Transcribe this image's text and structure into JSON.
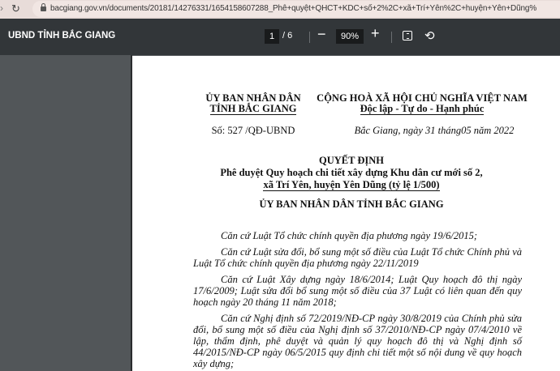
{
  "browser": {
    "url": "bacgiang.gov.vn/documents/20181/14276331/1654158607288_Phê+quyệt+QHCT+KDC+số+2%2C+xã+Trí+Yên%2C+huyện+Yên+Dũng%"
  },
  "toolbar": {
    "title": "UBND TỈNH BẮC GIANG",
    "current_page": "1",
    "page_total": "/ 6",
    "zoom": "90%",
    "zoom_out": "−",
    "zoom_in": "+",
    "rotate_icon": "⟲"
  },
  "document": {
    "left_header": [
      "ỦY BAN NHÂN DÂN",
      "TỈNH BẮC GIANG"
    ],
    "number": "Số: 527 /QĐ-UBND",
    "right_header": [
      "CỘNG HOÀ XÃ HỘI CHỦ NGHĨA VIỆT NAM",
      "Độc lập - Tự do - Hạnh phúc"
    ],
    "date": "Bắc Giang, ngày 31 tháng05  năm 2022",
    "title": "QUYẾT ĐỊNH",
    "subtitle": [
      "Phê duyệt Quy hoạch chi tiết xây dựng Khu dân cư mới số 2,",
      "xã Trí Yên, huyện Yên Dũng (tỷ lệ 1/500)"
    ],
    "authority": "ỦY BAN NHÂN DÂN TỈNH BẮC GIANG",
    "lines": [
      "Căn cứ Luật Tổ chức chính quyền địa phương ngày 19/6/2015;",
      "Căn cứ Luật sửa đổi, bổ sung một số điều của Luật Tổ chức Chính phủ và",
      "Luật Tổ chức chính quyền địa phương ngày 22/11/2019",
      "Căn cứ Luật Xây dựng ngày 18/6/2014; Luật Quy hoạch đô thị ngày",
      "17/6/2009; Luật sửa đổi bổ sung một số điều của 37 Luật có liên quan đến quy",
      "hoạch ngày 20 tháng 11 năm 2018;",
      "Căn cứ Nghị định số 72/2019/NĐ-CP ngày 30/8/2019 của Chính phủ sửa",
      "đổi, bổ sung một số điều của Nghị định số 37/2010/NĐ-CP ngày 07/4/2010 về",
      "lập, thẩm định, phê duyệt và quản lý quy hoạch đô thị và Nghị định số",
      "44/2015/NĐ-CP ngày 06/5/2015 quy định chi tiết một số nội dung về quy hoạch",
      "xây dựng;"
    ]
  }
}
